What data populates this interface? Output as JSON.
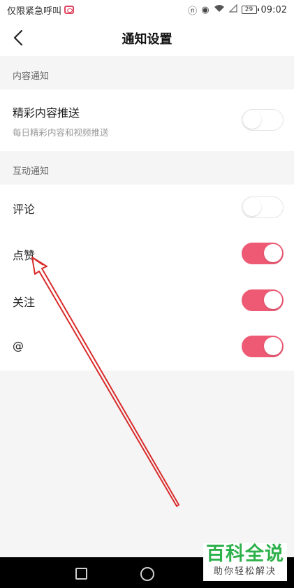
{
  "status_bar": {
    "left_text": "仅限紧急呼叫",
    "battery": "29",
    "time": "09:02"
  },
  "header": {
    "title": "通知设置"
  },
  "content_section": {
    "label": "内容通知",
    "items": [
      {
        "title": "精彩内容推送",
        "subtitle": "每日精彩内容和视频推送",
        "enabled": false
      }
    ]
  },
  "interaction_section": {
    "label": "互动通知",
    "items": [
      {
        "title": "评论",
        "enabled": false
      },
      {
        "title": "点赞",
        "enabled": true
      },
      {
        "title": "关注",
        "enabled": true
      },
      {
        "title": "@",
        "enabled": true
      }
    ]
  },
  "watermark": {
    "main": "百科全说",
    "sub": "助你轻松解决"
  },
  "colors": {
    "toggle_on": "#ee5a74",
    "toggle_off_border": "#e4e4e4",
    "watermark_green": "#2db14a",
    "annotation_red": "#d92a2a"
  }
}
